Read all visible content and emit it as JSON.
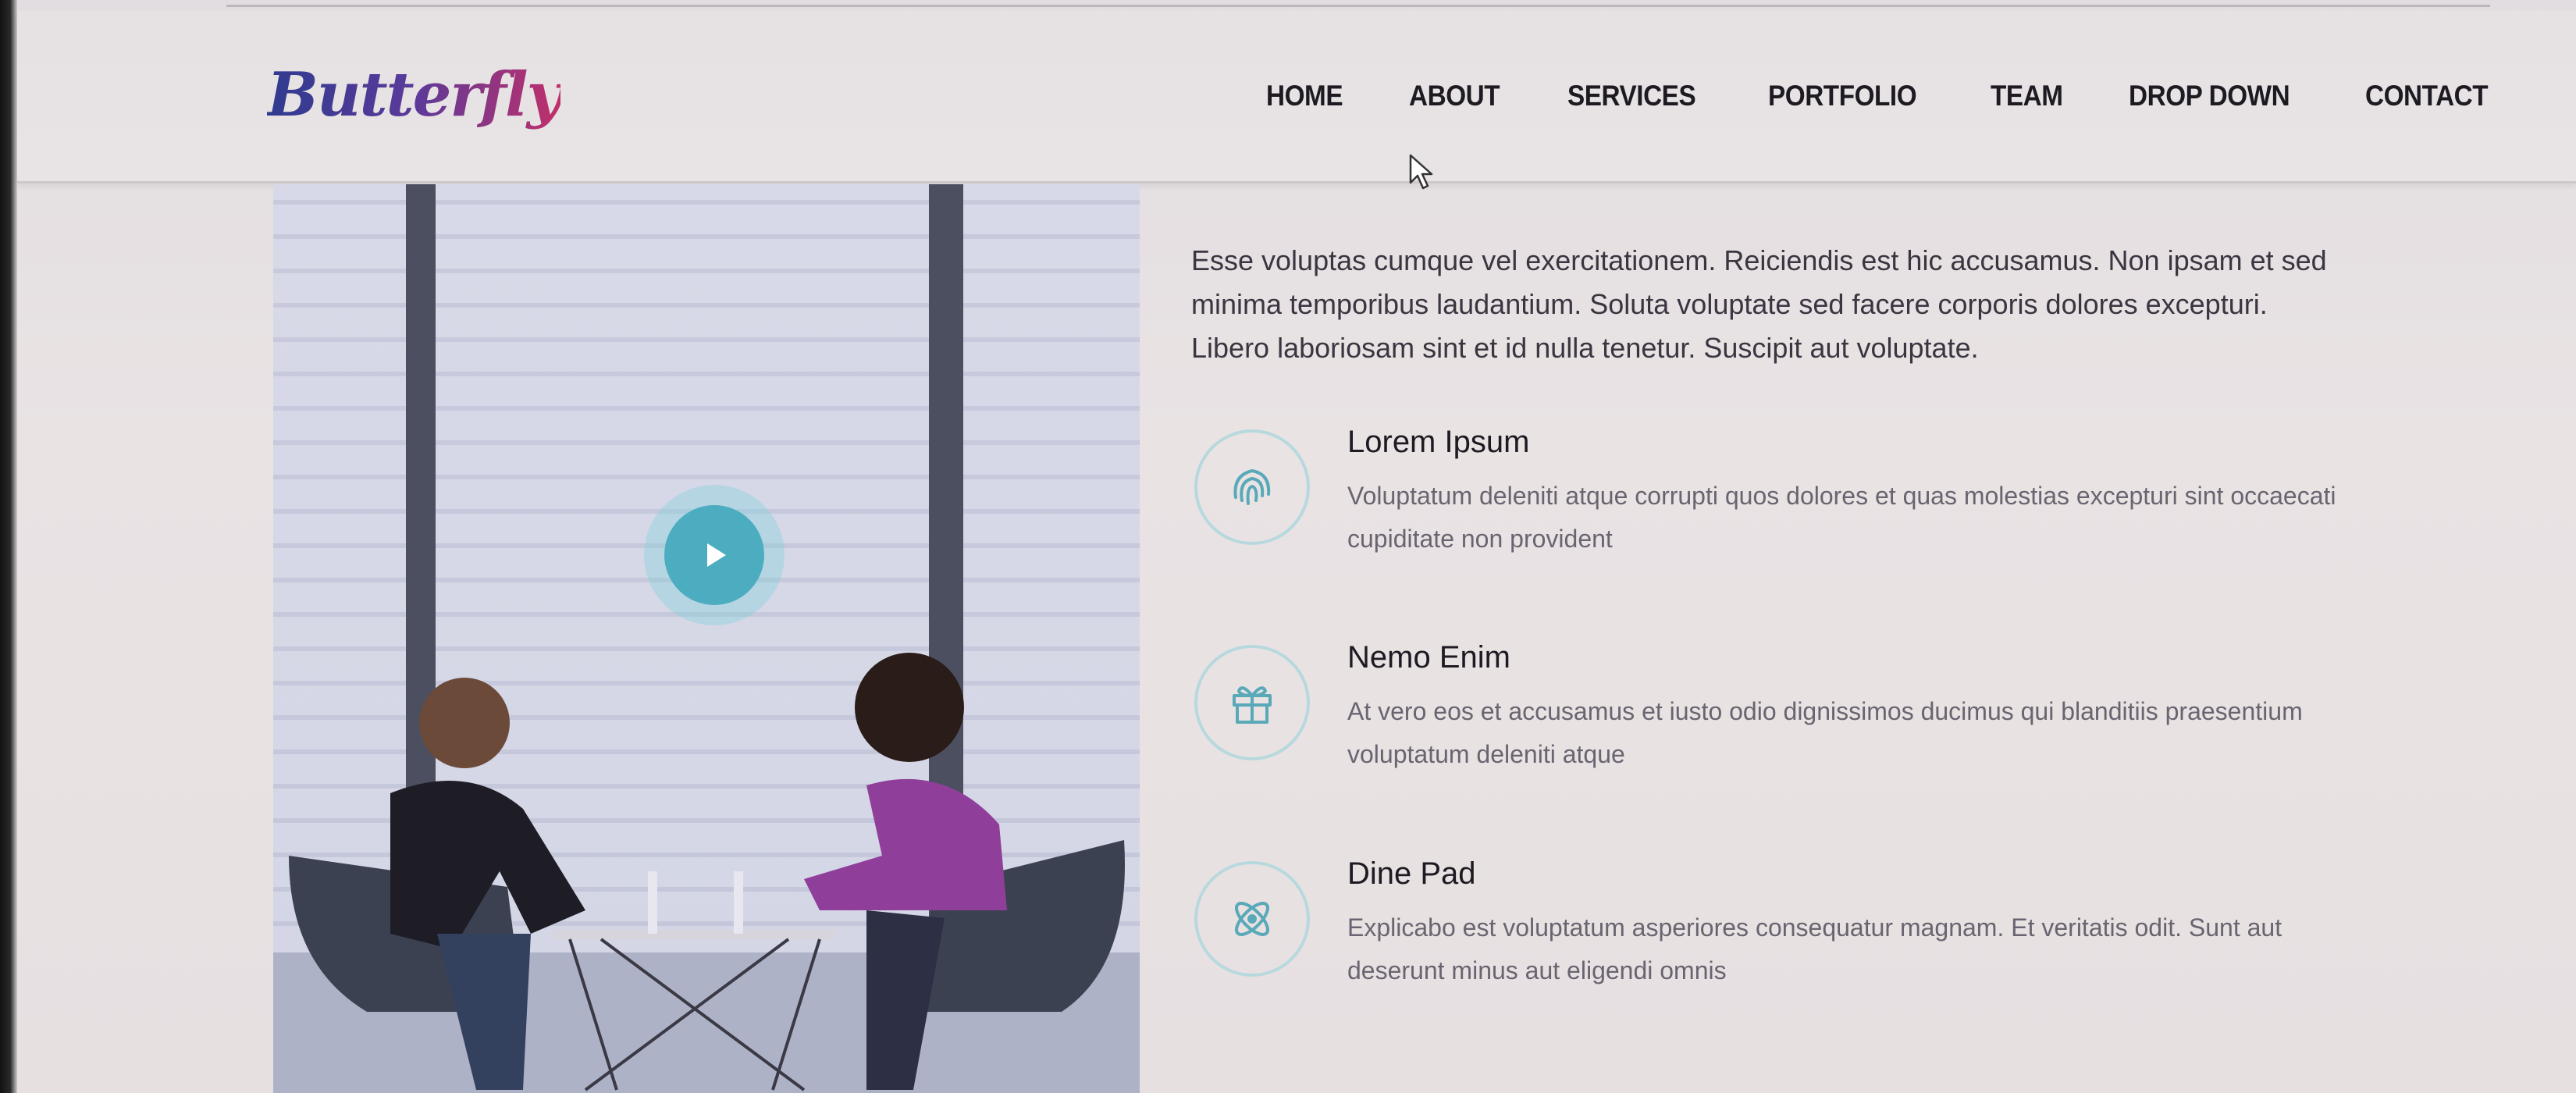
{
  "brand": {
    "logo_text": "Butterfly"
  },
  "nav": {
    "items": [
      {
        "label": "HOME"
      },
      {
        "label": "ABOUT"
      },
      {
        "label": "SERVICES"
      },
      {
        "label": "PORTFOLIO"
      },
      {
        "label": "TEAM"
      },
      {
        "label": "DROP DOWN"
      },
      {
        "label": "CONTACT"
      }
    ]
  },
  "about": {
    "intro": "Esse voluptas cumque vel exercitationem. Reiciendis est hic accusamus. Non ipsam et sed minima temporibus laudantium. Soluta voluptate sed facere corporis dolores excepturi. Libero laboriosam sint et id nulla tenetur. Suscipit aut voluptate.",
    "features": [
      {
        "icon": "fingerprint-icon",
        "title": "Lorem Ipsum",
        "text": "Voluptatum deleniti atque corrupti quos dolores et quas molestias excepturi sint occaecati cupiditate non provident"
      },
      {
        "icon": "gift-icon",
        "title": "Nemo Enim",
        "text": "At vero eos et accusamus et iusto odio dignissimos ducimus qui blanditiis praesentium voluptatum deleniti atque"
      },
      {
        "icon": "atom-icon",
        "title": "Dine Pad",
        "text": "Explicabo est voluptatum asperiores consequatur magnam. Et veritatis odit. Sunt aut deserunt minus aut eligendi omnis"
      }
    ]
  },
  "colors": {
    "accent": "#4cadc0",
    "icon_ring": "#b7d9de",
    "text_dark": "#1d1a22",
    "text_muted": "#6a6470"
  }
}
